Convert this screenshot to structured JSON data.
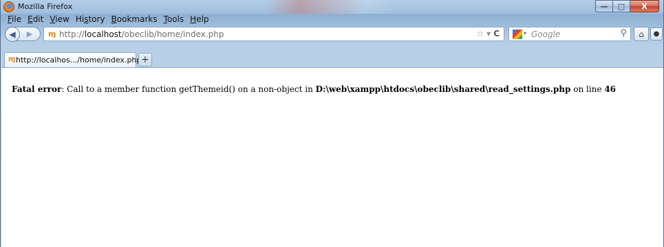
{
  "window": {
    "title": "Mozilla Firefox",
    "controls": {
      "minimize": "—",
      "maximize": "□",
      "close": "X"
    }
  },
  "menu": {
    "items": [
      {
        "accel": "F",
        "rest": "ile"
      },
      {
        "accel": "E",
        "rest": "dit"
      },
      {
        "accel": "V",
        "rest": "iew"
      },
      {
        "pre": "Hi",
        "accel": "s",
        "rest": "tory"
      },
      {
        "accel": "B",
        "rest": "ookmarks"
      },
      {
        "accel": "T",
        "rest": "ools"
      },
      {
        "accel": "H",
        "rest": "elp"
      }
    ]
  },
  "nav": {
    "back_glyph": "◀",
    "forward_glyph": "▶",
    "url_prefix": "http://",
    "url_host": "localhost",
    "url_path": "/obeclib/home/index.php",
    "bookmark_glyph": "☆",
    "dropdown_glyph": "▾",
    "reload_glyph": "C",
    "search_placeholder": "Google",
    "search_glyph": "⚲",
    "home_glyph": "⌂",
    "ext_glyph": "●"
  },
  "tabs": {
    "active_label": "http://localhos.../home/index.php",
    "new_tab_glyph": "+"
  },
  "page": {
    "error_label": "Fatal error",
    "error_message": ": Call to a member function getThemeid() on a non-object in ",
    "error_file": "D:\\web\\xampp\\htdocs\\obeclib\\shared\\read_settings.php",
    "error_line_text": " on line ",
    "error_line_number": "46"
  },
  "colors": {
    "chrome": "#a9c4df",
    "close_button": "#c2432c",
    "page_background": "#ffffff"
  }
}
